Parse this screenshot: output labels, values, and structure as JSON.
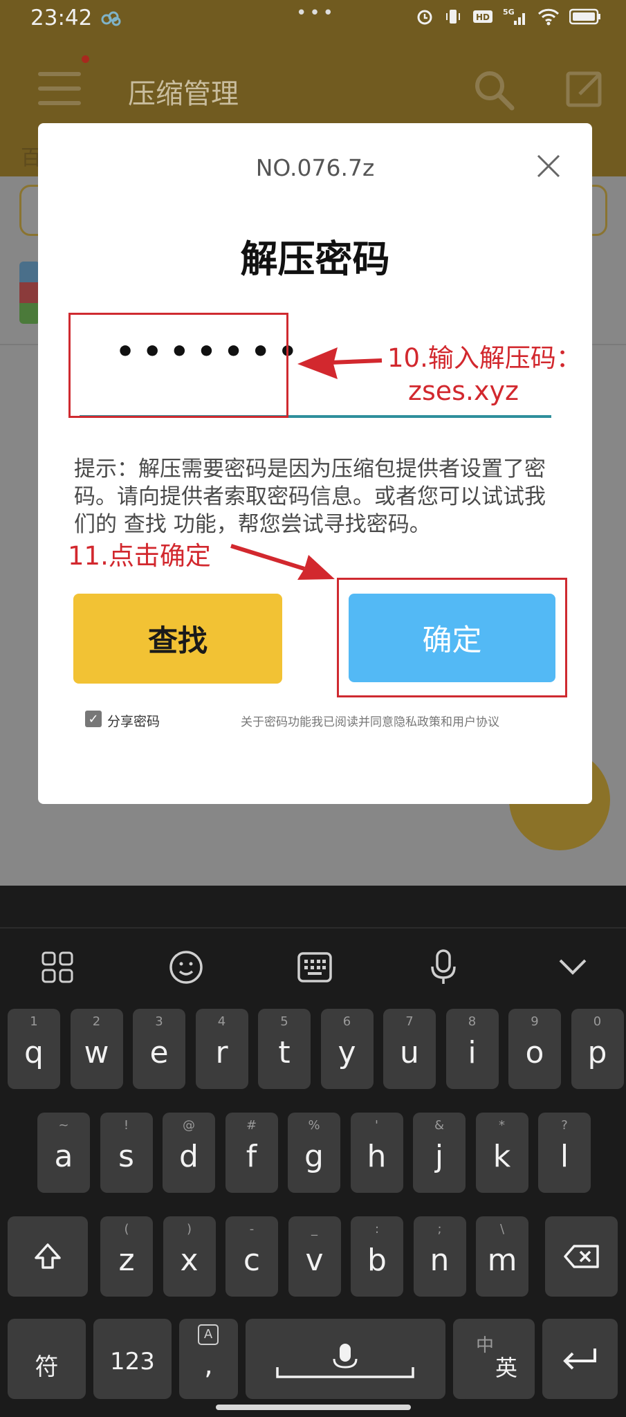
{
  "status_bar": {
    "time": "23:42",
    "dots": "•••"
  },
  "app": {
    "title": "压缩管理",
    "tab_partial": "百"
  },
  "dialog": {
    "filename": "NO.076.7z",
    "title": "解压密码",
    "password_masked": "•••••••",
    "hint": "提示：解压需要密码是因为压缩包提供者设置了密码。请向提供者索取密码信息。或者您可以试试我们的 查找 功能，帮您尝试寻找密码。",
    "find_button": "查找",
    "ok_button": "确定",
    "share_label": "分享密码",
    "agreement": "关于密码功能我已阅读并同意隐私政策和用户协议"
  },
  "annotations": {
    "step10_line1": "10.输入解压码：",
    "step10_line2": "zses.xyz",
    "step11": "11.点击确定"
  },
  "keyboard": {
    "row1": [
      {
        "k": "q",
        "n": "1"
      },
      {
        "k": "w",
        "n": "2"
      },
      {
        "k": "e",
        "n": "3"
      },
      {
        "k": "r",
        "n": "4"
      },
      {
        "k": "t",
        "n": "5"
      },
      {
        "k": "y",
        "n": "6"
      },
      {
        "k": "u",
        "n": "7"
      },
      {
        "k": "i",
        "n": "8"
      },
      {
        "k": "o",
        "n": "9"
      },
      {
        "k": "p",
        "n": "0"
      }
    ],
    "row2": [
      {
        "k": "a",
        "n": "~"
      },
      {
        "k": "s",
        "n": "!"
      },
      {
        "k": "d",
        "n": "@"
      },
      {
        "k": "f",
        "n": "#"
      },
      {
        "k": "g",
        "n": "%"
      },
      {
        "k": "h",
        "n": "'"
      },
      {
        "k": "j",
        "n": "&"
      },
      {
        "k": "k",
        "n": "*"
      },
      {
        "k": "l",
        "n": "?"
      }
    ],
    "row3": [
      {
        "k": "z",
        "n": "("
      },
      {
        "k": "x",
        "n": ")"
      },
      {
        "k": "c",
        "n": "-"
      },
      {
        "k": "v",
        "n": "_"
      },
      {
        "k": "b",
        "n": ":"
      },
      {
        "k": "n",
        "n": ";"
      },
      {
        "k": "m",
        "n": "\\"
      }
    ],
    "symbols_key": "符",
    "numbers_key": "123",
    "comma_key": ",",
    "comma_badge": "A",
    "period_key": "·",
    "lang_key_zh": "中",
    "lang_key_en": "英"
  }
}
